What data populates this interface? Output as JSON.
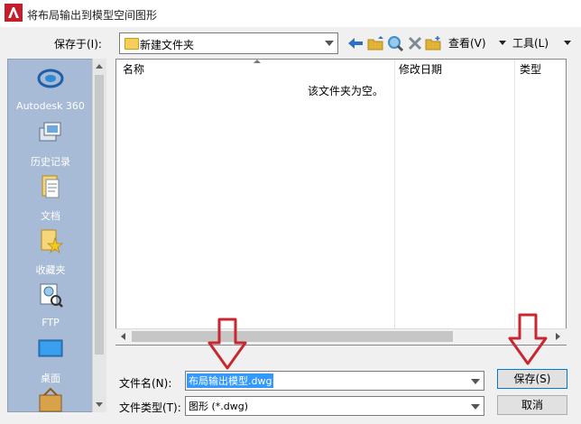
{
  "window": {
    "title": "将布局输出到模型空间图形"
  },
  "toolbar": {
    "save_in_label": "保存于(I):",
    "current_folder": "新建文件夹",
    "buttons": [
      {
        "name": "back-icon",
        "color": "#2e6fbf"
      },
      {
        "name": "up-folder-icon",
        "color": "#e0b337"
      },
      {
        "name": "search-web-icon",
        "color": "#3a8fd0"
      },
      {
        "name": "delete-icon",
        "color": "#7f8a96"
      },
      {
        "name": "new-folder-icon",
        "color": "#e0b337"
      }
    ],
    "views_label": "查看(V)",
    "tools_label": "工具(L)"
  },
  "places": [
    {
      "label": "Autodesk 360",
      "icon": "autodesk-360-icon"
    },
    {
      "label": "历史记录",
      "icon": "history-icon"
    },
    {
      "label": "文档",
      "icon": "documents-icon"
    },
    {
      "label": "收藏夹",
      "icon": "favorites-icon"
    },
    {
      "label": "FTP",
      "icon": "ftp-icon"
    },
    {
      "label": "桌面",
      "icon": "desktop-icon"
    },
    {
      "label": "",
      "icon": "buzzsaw-icon"
    }
  ],
  "file_list": {
    "columns": [
      "名称",
      "修改日期",
      "类型"
    ],
    "empty_message": "该文件夹为空。"
  },
  "bottom": {
    "filename_label": "文件名(N):",
    "filename_value": "布局输出模型.dwg",
    "filetype_label": "文件类型(T):",
    "filetype_value": "图形 (*.dwg)",
    "save_button": "保存(S)",
    "cancel_button": "取消"
  },
  "colors": {
    "annotation_arrow": "#c8272f",
    "sidebar": "#a8bbd6",
    "selection": "#3399ff"
  }
}
